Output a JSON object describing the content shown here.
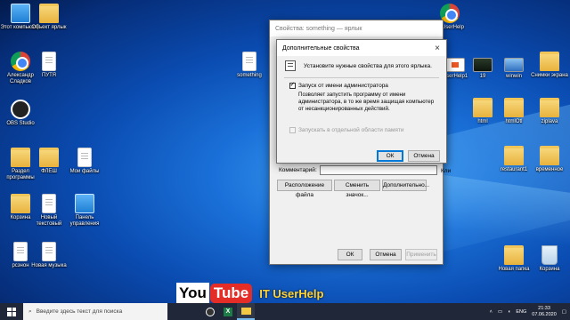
{
  "desktop": {
    "icons": [
      {
        "id": "pc",
        "label": "Этот компьютер"
      },
      {
        "id": "yarlyk",
        "label": "Объект ярлык"
      },
      {
        "id": "chrome-user",
        "label": "Александр Сладков"
      },
      {
        "id": "pusto",
        "label": "ПУТЯ"
      },
      {
        "id": "obs",
        "label": "OBS Studio"
      },
      {
        "id": "razdel",
        "label": "Раздел программы"
      },
      {
        "id": "doc2",
        "label": "ФЛЕШ"
      },
      {
        "id": "mysecret",
        "label": "Мои файлы"
      },
      {
        "id": "korzina",
        "label": "Корзина"
      },
      {
        "id": "new-text",
        "label": "Новый текстовый"
      },
      {
        "id": "panel",
        "label": "Панель управления"
      },
      {
        "id": "reshon",
        "label": "рсзнон"
      },
      {
        "id": "new-muzika",
        "label": "Новая музыка"
      },
      {
        "id": "something",
        "label": "something"
      },
      {
        "id": "chrome-right",
        "label": "IT UserHelp"
      },
      {
        "id": "userhelp1",
        "label": "UserHelp1"
      },
      {
        "id": "n19",
        "label": "19"
      },
      {
        "id": "winwin",
        "label": "winwin"
      },
      {
        "id": "snimki",
        "label": "Снимки экрана"
      },
      {
        "id": "html",
        "label": "html"
      },
      {
        "id": "htmlotl",
        "label": "htmlOtl"
      },
      {
        "id": "ziplava",
        "label": "ziplava"
      },
      {
        "id": "restaurant",
        "label": "restaurant1"
      },
      {
        "id": "vremennoe",
        "label": "временное"
      },
      {
        "id": "new-folder",
        "label": "Новая папка"
      },
      {
        "id": "recycle",
        "label": "Корзина"
      }
    ]
  },
  "props_window": {
    "title": "Свойства: something — ярлык",
    "comment_label": "Комментарий:",
    "btn_location": "Расположение файла",
    "btn_change_icon": "Сменить значок...",
    "btn_advanced": "Дополнительно...",
    "btn_ok": "ОК",
    "btn_cancel": "Отмена",
    "btn_apply": "Применить",
    "side_label": "Кли"
  },
  "advanced_dialog": {
    "title": "Дополнительные свойства",
    "close": "×",
    "intro": "Установите нужные свойства для этого ярлыка.",
    "run_as_admin_label": "Запуск от имени администратора",
    "run_as_admin_checked": true,
    "description": "Позволяет запустить программу от имени администратора, в то же время защищая компьютер от несанкционированных действий.",
    "separate_memory_label": "Запускать в отдельной области памяти",
    "btn_ok": "ОК",
    "btn_cancel": "Отмена"
  },
  "watermark": {
    "you": "You",
    "tube": "Tube",
    "channel": "IT UserHelp"
  },
  "taskbar": {
    "search_placeholder": "Введите здесь текст для поиска",
    "lang": "ENG",
    "time": "21:33",
    "date": "07.06.2020"
  }
}
